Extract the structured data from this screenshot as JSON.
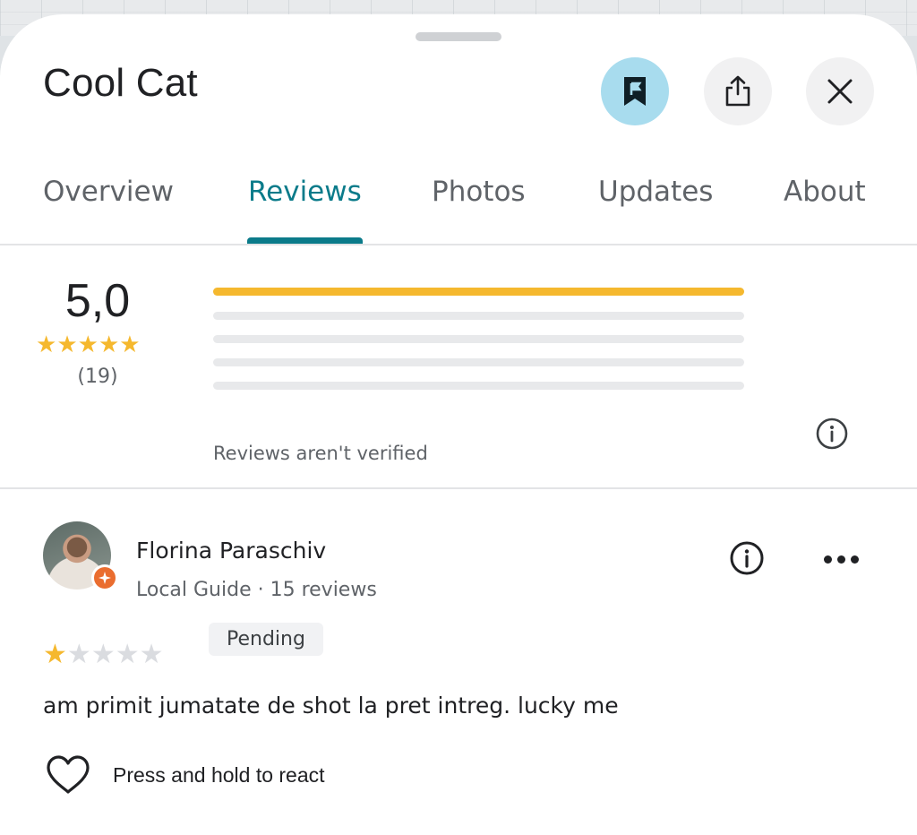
{
  "place": {
    "title": "Cool Cat"
  },
  "header_actions": {
    "save_icon": "bookmark-flag-icon",
    "share_icon": "share-icon",
    "close_icon": "close-icon",
    "accent_color": "#a8dcee"
  },
  "tabs": [
    {
      "label": "Overview",
      "active": false
    },
    {
      "label": "Reviews",
      "active": true
    },
    {
      "label": "Photos",
      "active": false
    },
    {
      "label": "Updates",
      "active": false
    },
    {
      "label": "About",
      "active": false
    }
  ],
  "rating_summary": {
    "value": "5,0",
    "stars": 5,
    "count": "(19)",
    "distribution_fraction": [
      1.0,
      0,
      0,
      0,
      0
    ],
    "bar_color": "#f5b82e",
    "unverified_note": "Reviews aren't verified"
  },
  "review": {
    "author": "Florina Paraschiv",
    "meta": "Local Guide · 15 reviews",
    "stars": 1,
    "status": "Pending",
    "text": "am primit jumatate de shot la pret intreg. lucky me",
    "react_label": "Press and hold to react"
  }
}
